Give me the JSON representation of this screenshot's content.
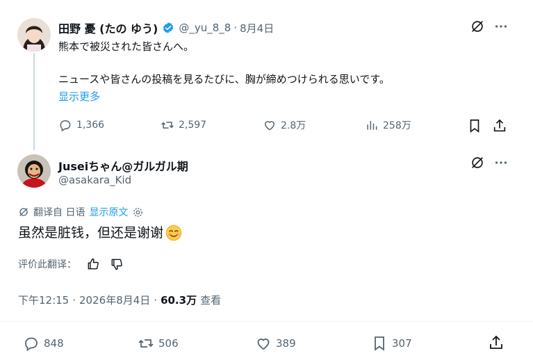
{
  "tweet1": {
    "display_name": "田野 憂 (たの ゆう)",
    "handle": "@_yu_8_8",
    "separator": "·",
    "date": "8月4日",
    "line1": "熊本で被災された皆さんへ。",
    "line2": "ニュースや皆さんの投稿を見るたびに、胸が締めつけられる思いです。",
    "show_more": "显示更多",
    "replies": "1,366",
    "retweets": "2,597",
    "likes": "2.8万",
    "views": "258万"
  },
  "tweet2": {
    "display_name": "Juseiちゃん@ガルガル期",
    "handle": "@asakara_Kid",
    "translated_from": "翻译自 日语",
    "show_original": "显示原文",
    "text": "虽然是脏钱，但还是谢谢",
    "rate_translation": "评价此翻译：",
    "time": "下午12:15",
    "sep1": "·",
    "date": "2026年8月4日",
    "sep2": "·",
    "views_count": "60.3万",
    "views_label": "查看",
    "replies": "848",
    "retweets": "506",
    "likes": "389",
    "bookmarks": "307"
  },
  "colors": {
    "link": "#1d9bf0",
    "muted": "#536471",
    "verified": "#1d9bf0"
  }
}
